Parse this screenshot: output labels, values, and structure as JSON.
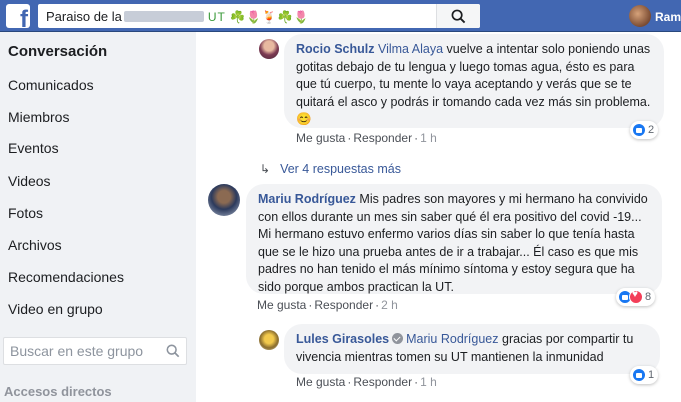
{
  "topbar": {
    "logo_letter": "f",
    "search_value": "Paraiso de la",
    "search_emoji": "UT ☘️🌷🍹☘️🌷",
    "user_name": "Ram"
  },
  "sidebar": {
    "items": [
      {
        "label": "Conversación",
        "active": true
      },
      {
        "label": "Comunicados"
      },
      {
        "label": "Miembros"
      },
      {
        "label": "Eventos"
      },
      {
        "label": "Videos"
      },
      {
        "label": "Fotos"
      },
      {
        "label": "Archivos"
      },
      {
        "label": "Recomendaciones"
      },
      {
        "label": "Video en grupo"
      }
    ],
    "search_placeholder": "Buscar en este grupo",
    "section_title": "Accesos directos"
  },
  "feed": {
    "comment1": {
      "author": "Rocio Schulz",
      "mention": "Vilma Alaya",
      "text": "vuelve a intentar solo poniendo unas gotitas debajo de tu lengua y luego tomas agua, ésto es para que tú cuerpo, tu mente lo vaya aceptando y verás que se te quitará el asco y podrás ir tomando cada vez más sin problema.",
      "emoji": "😊",
      "like_label": "Me gusta",
      "reply_label": "Responder",
      "time": "1 h",
      "reaction_count": "2"
    },
    "more_replies": "Ver 4 respuestas más",
    "comment2": {
      "author": "Mariu Rodríguez",
      "text": "Mis padres son mayores y mi hermano ha convivido con ellos durante un mes sin saber qué él era positivo del covid -19... Mi hermano estuvo enfermo varios días sin saber lo que tenía hasta que se le hizo una prueba antes de ir a trabajar... Él caso es que mis padres no han tenido el más mínimo síntoma y estoy segura que ha sido porque ambos practican la UT.",
      "like_label": "Me gusta",
      "reply_label": "Responder",
      "time": "2 h",
      "reaction_count": "8"
    },
    "comment3": {
      "author": "Lules Girasoles",
      "mention": "Mariu Rodríguez",
      "text": "gracias por compartir tu vivencia mientras tomen su UT mantienen la inmunidad",
      "like_label": "Me gusta",
      "reply_label": "Responder",
      "time": "1 h",
      "reaction_count": "1"
    }
  },
  "colors": {
    "brand": "#4267b2",
    "link": "#385898",
    "bubble": "#f2f3f5"
  }
}
